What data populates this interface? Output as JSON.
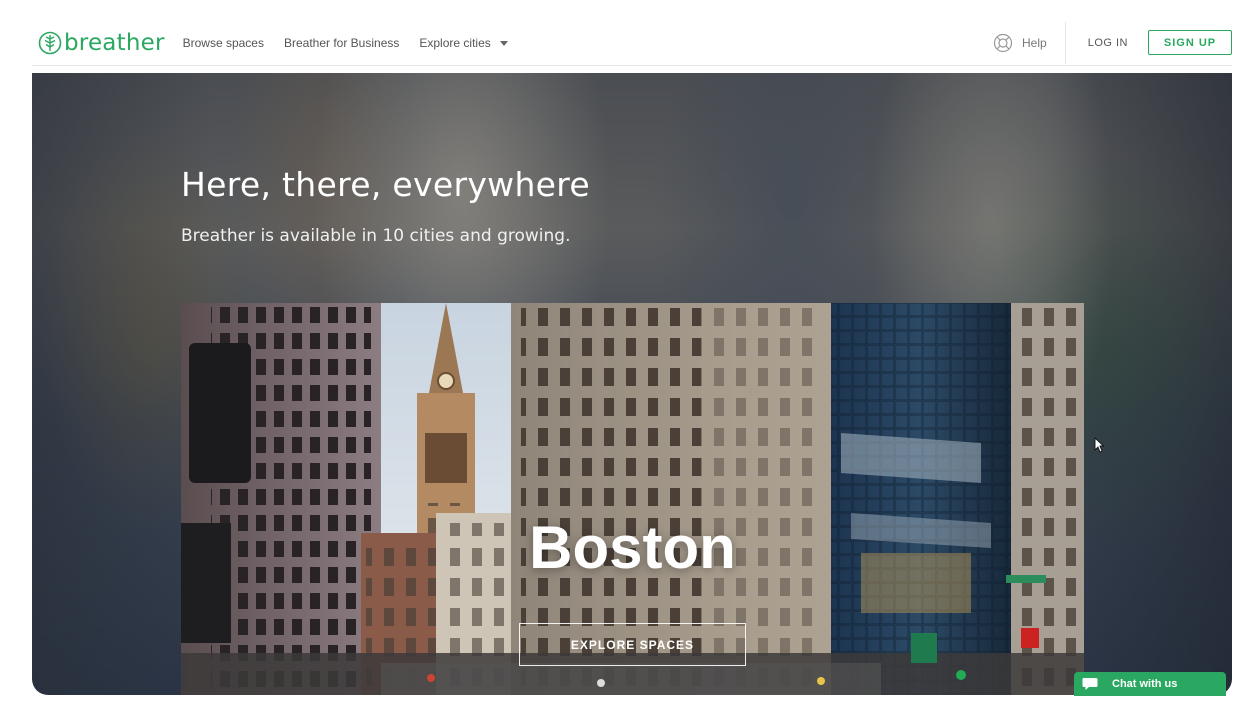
{
  "brand": {
    "name": "breather",
    "color": "#2aa861",
    "icon": "leaf-logo-icon"
  },
  "nav": {
    "links": [
      "Browse spaces",
      "Breather for Business"
    ],
    "explore_label": "Explore cities",
    "help_label": "Help",
    "login_label": "LOG IN",
    "signup_label": "SIGN UP"
  },
  "hero": {
    "title": "Here, there, everywhere",
    "subtitle": "Breather is available in 10 cities and growing."
  },
  "city_card": {
    "city": "Boston",
    "button_label": "EXPLORE SPACES"
  },
  "chat": {
    "label": "Chat with us",
    "icon": "chat-bubble-icon"
  }
}
